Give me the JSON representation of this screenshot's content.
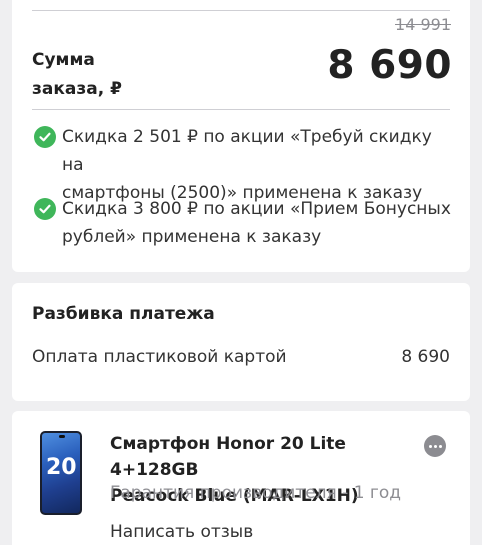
{
  "summary": {
    "old_price": "14 991",
    "sum_label_line1": "Сумма",
    "sum_label_line2": "заказа, ₽",
    "total": "8 690",
    "discounts": [
      {
        "line1": "Скидка 2 501 ₽ по акции «Требуй скидку на",
        "line2": "смартфоны (2500)» применена к заказу"
      },
      {
        "line1": "Скидка 3 800 ₽ по акции «Прием Бонусных",
        "line2": "рублей» применена к заказу"
      }
    ]
  },
  "payment": {
    "title": "Разбивка платежа",
    "method": "Оплата пластиковой картой",
    "amount": "8 690"
  },
  "product": {
    "image_label": "20",
    "title_line1": "Смартфон Honor 20 Lite 4+128GB",
    "title_line2": "Peacock Blue (MAR-LX1H)",
    "warranty": "Гарантия производителя - 1 год",
    "review_link": "Написать отзыв"
  },
  "colors": {
    "check_green": "#3fb65a",
    "background": "#efeff1"
  }
}
